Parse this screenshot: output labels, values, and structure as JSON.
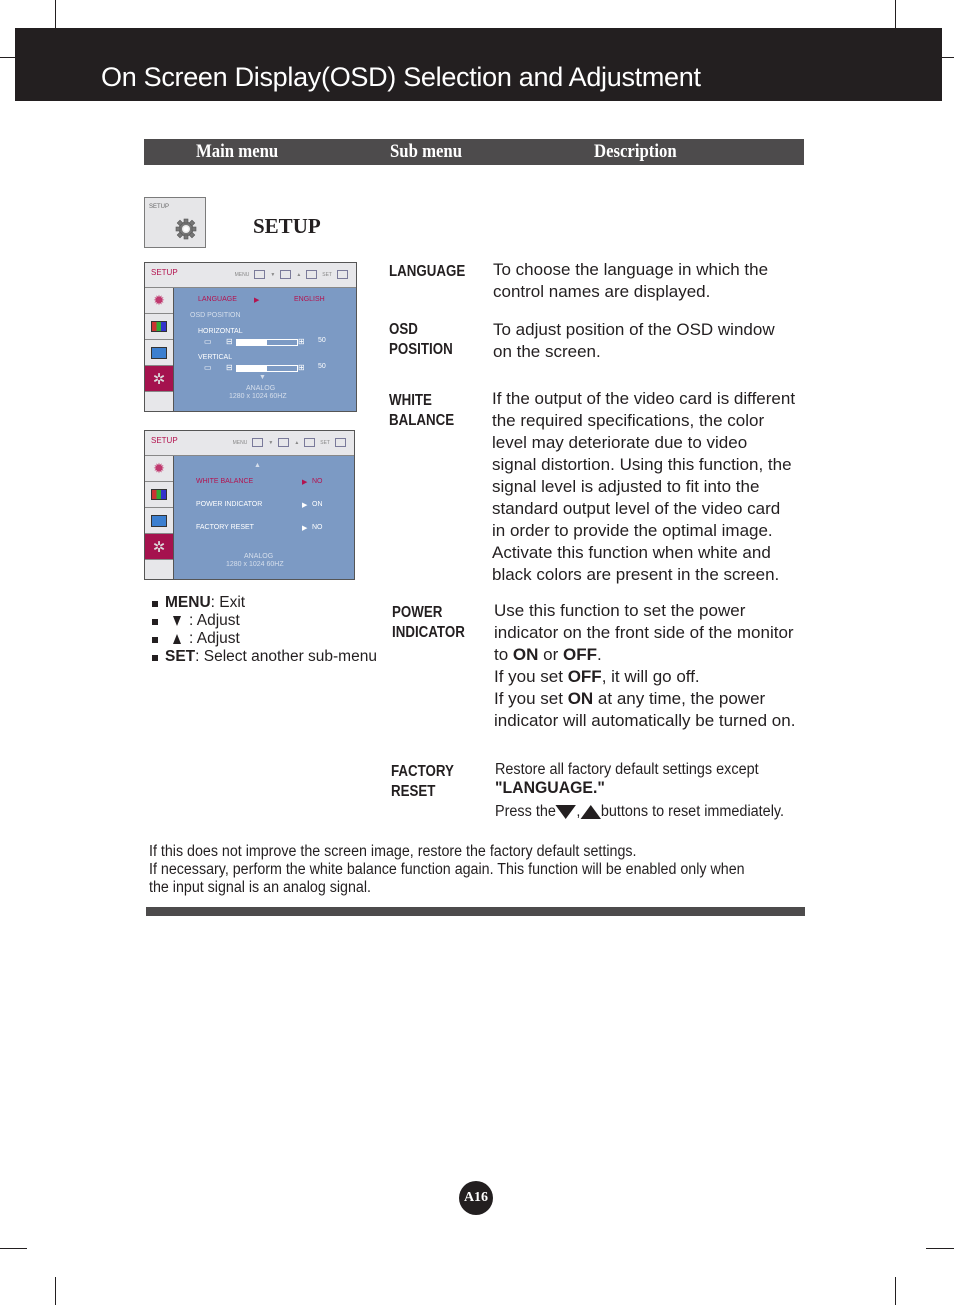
{
  "page": {
    "title": "On Screen Display(OSD) Selection and Adjustment",
    "page_number": "A16"
  },
  "columns": {
    "main_menu": "Main menu",
    "sub_menu": "Sub menu",
    "description": "Description"
  },
  "main_menu": {
    "thumb_label": "SETUP",
    "icon": "gear-icon",
    "heading": "SETUP"
  },
  "osd_screen_1": {
    "title": "SETUP",
    "keys": [
      "MENU",
      "▼",
      "▲",
      "SET"
    ],
    "side_icons": [
      "brightness-icon",
      "color-icon",
      "tracking-icon",
      "setup-gear-icon"
    ],
    "active_side_index": 3,
    "language_label": "LANGUAGE",
    "language_value": "ENGLISH",
    "osd_position_label": "OSD  POSITION",
    "horizontal_label": "HORIZONTAL",
    "horizontal_value": "50",
    "horizontal_fraction": 0.5,
    "vertical_label": "VERTICAL",
    "vertical_value": "50",
    "vertical_fraction": 0.5,
    "signal": "ANALOG",
    "resolution": "1280 x 1024  60HZ"
  },
  "osd_screen_2": {
    "title": "SETUP",
    "keys": [
      "MENU",
      "▼",
      "▲",
      "SET"
    ],
    "items": [
      {
        "label": "WHITE  BALANCE",
        "value": "NO",
        "selected": true
      },
      {
        "label": "POWER  INDICATOR",
        "value": "ON",
        "selected": false
      },
      {
        "label": "FACTORY  RESET",
        "value": "NO",
        "selected": false
      }
    ],
    "signal": "ANALOG",
    "resolution": "1280 x 1024  60HZ"
  },
  "legend": {
    "menu_key": "MENU",
    "menu_action": " : Exit",
    "down_action": ": Adjust",
    "up_action": ": Adjust",
    "set_key": "SET",
    "set_action": " : Select another sub-menu"
  },
  "submenus": {
    "language": {
      "label": "LANGUAGE",
      "desc": [
        "To choose the language in which the",
        "control names are displayed."
      ]
    },
    "osd_position": {
      "label_1": "OSD",
      "label_2": "POSITION",
      "desc": [
        "To adjust position of the OSD window",
        "on the screen."
      ]
    },
    "white_balance": {
      "label_1": "WHITE",
      "label_2": "BALANCE",
      "desc": [
        "If the output of the video card is different",
        "the required specifications, the color",
        "level may deteriorate due to video",
        "signal distortion. Using this function, the",
        "signal level is adjusted to fit into the",
        "standard output level of the video card",
        "in order to provide the optimal image.",
        "Activate this function when white and",
        "black colors are present in the screen."
      ]
    },
    "power_indicator": {
      "label_1": "POWER",
      "label_2": "INDICATOR",
      "line1": "Use this function to set the power",
      "line2": "indicator on the front side of the monitor",
      "line3_a": "to ",
      "line3_on": "ON",
      "line3_b": " or ",
      "line3_off": "OFF",
      "line3_c": ".",
      "line4_a": "If you set ",
      "line4_off": "OFF",
      "line4_b": ", it will go off.",
      "line5_a": "If you set ",
      "line5_on": "ON",
      "line5_b": " at any time, the power",
      "line6": "indicator will automatically be turned on."
    },
    "factory_reset": {
      "label_1": "FACTORY",
      "label_2": "RESET",
      "line1": "Restore all factory default settings except",
      "line2": "\"LANGUAGE.\"",
      "line3_a": "Press the ",
      "line3_sep": " , ",
      "line3_b": " buttons to reset immediately."
    }
  },
  "note": [
    "If this does not improve the screen image, restore the factory default settings.",
    "If necessary, perform the white balance function again. This function will be enabled only when",
    "the input signal is an analog signal."
  ]
}
